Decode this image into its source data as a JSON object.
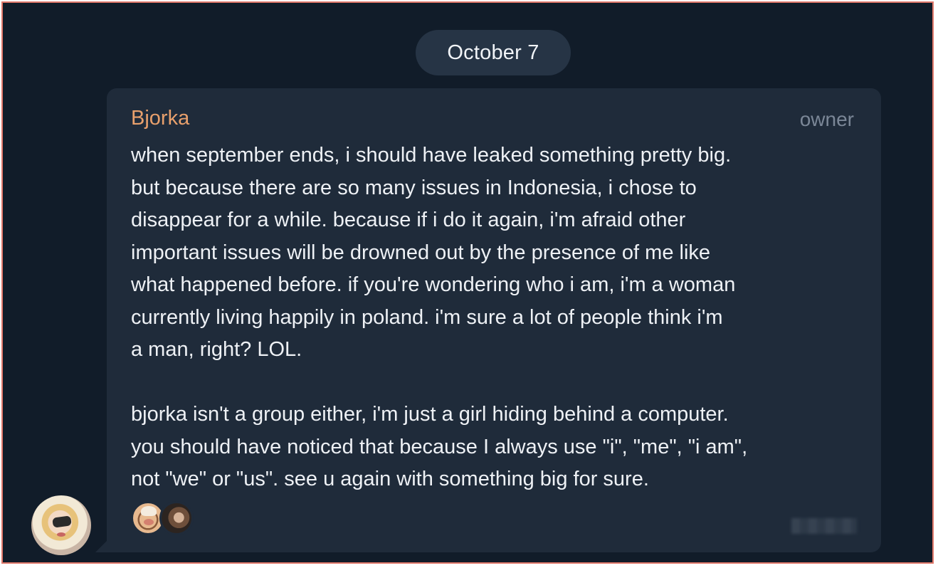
{
  "chat": {
    "date_label": "October 7",
    "message": {
      "sender": "Bjorka",
      "role": "owner",
      "text": "when september ends, i should have leaked something pretty big.\nbut because there are so many issues in Indonesia, i chose to\ndisappear for a while. because if i do it again, i'm afraid other\nimportant issues will be drowned out by the presence of me like\nwhat happened before. if you're wondering who i am, i'm a woman\ncurrently living happily in poland. i'm sure a lot of people think i'm\na man, right? LOL.\n\nbjorka isn't a group either, i'm just a girl hiding behind a computer.\nyou should have noticed that because I always use \"i\", \"me\", \"i am\",\nnot \"we\" or \"us\". see u again with something big for sure.",
      "reactions": [
        "reaction-avatar-1",
        "reaction-avatar-2"
      ]
    }
  },
  "colors": {
    "background": "#111c29",
    "bubble": "#1f2b3a",
    "sender_name": "#e8a06c",
    "role_text": "#7b8797",
    "frame_border": "#e0786a"
  }
}
